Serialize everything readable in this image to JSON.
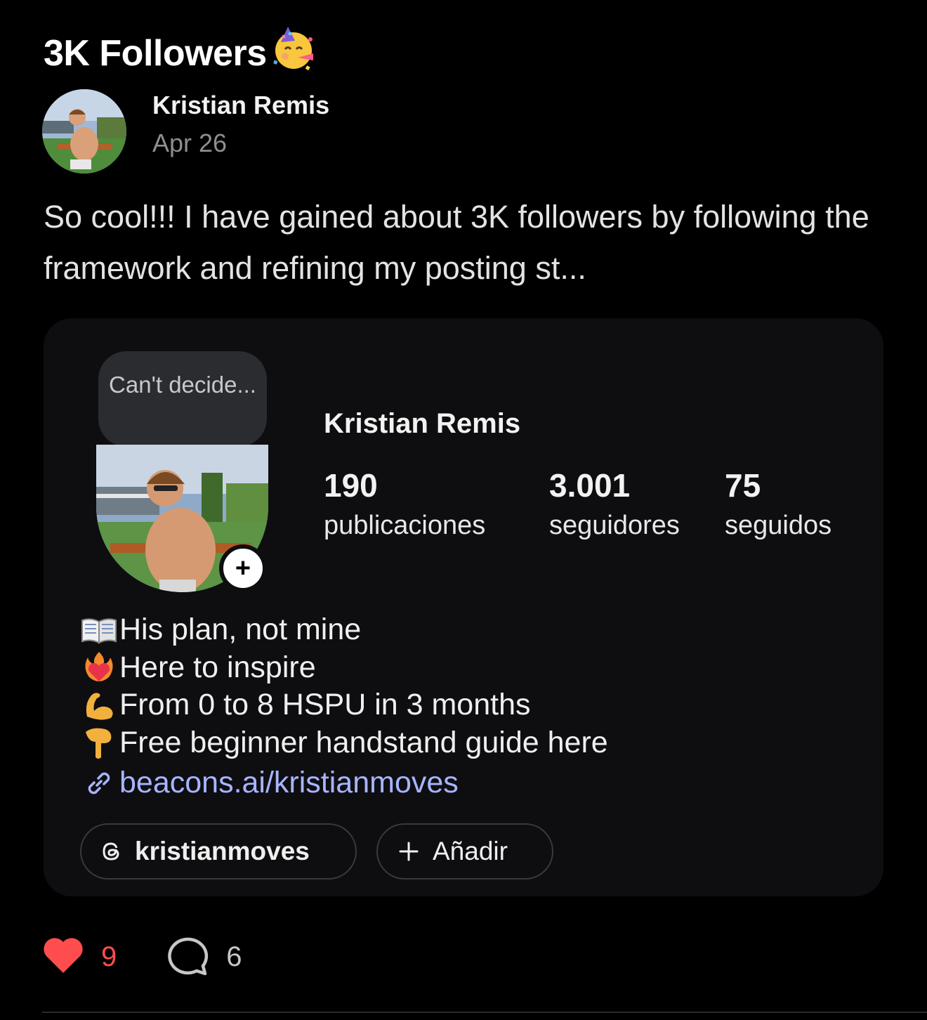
{
  "post": {
    "title": "3K Followers",
    "title_emoji": "partying-face-emoji",
    "author": "Kristian Remis",
    "date": "Apr 26",
    "body": "So cool!!! I have gained about 3K followers by following the framework and refining my posting st...",
    "likes": "9",
    "replies": "6"
  },
  "profile_card": {
    "note_bubble": "Can't decide...",
    "name": "Kristian Remis",
    "stats": [
      {
        "value": "190",
        "label": "publicaciones"
      },
      {
        "value": "3.001",
        "label": "seguidores"
      },
      {
        "value": "75",
        "label": "seguidos"
      }
    ],
    "bio": [
      {
        "icon": "open-book-emoji",
        "text": "His plan, not mine"
      },
      {
        "icon": "heart-on-fire-emoji",
        "text": "Here to inspire"
      },
      {
        "icon": "flexed-biceps-emoji",
        "text": "From 0 to 8 HSPU in 3 months"
      },
      {
        "icon": "backhand-index-down-emoji",
        "text": "Free beginner handstand guide here"
      }
    ],
    "link": "beacons.ai/kristianmoves",
    "threads_handle": "kristianmoves",
    "add_label": "Añadir"
  },
  "colors": {
    "background": "#000000",
    "card": "#0e0e11",
    "link": "#a8b4ff",
    "like": "#ff4d4d",
    "muted": "#8e8e93"
  }
}
